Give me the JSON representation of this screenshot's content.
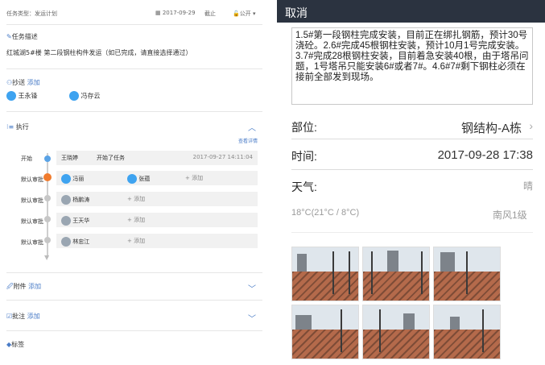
{
  "left": {
    "task_type": "任务类型：发运计划",
    "date": "2017-09-29",
    "due": "截止",
    "visibility": "公开",
    "desc_title": "任务描述",
    "desc_text": "红城湖5#楼 第二段钢柱构件发运（如已完成，请直接选择通过）",
    "cc_title": "抄送",
    "cc_add": "添加",
    "cc_people": [
      "王永锋",
      "冯存云"
    ],
    "exec_title": "执行",
    "view_details": "查看详情",
    "steps": [
      {
        "label": "开始",
        "name": "王晓婷",
        "action": "开始了任务",
        "time": "2017-09-27 14:11:04"
      },
      {
        "label": "默认审批",
        "name": "冯丽",
        "second": "张蕴",
        "add": "+ 添加"
      },
      {
        "label": "默认审批",
        "name": "杨鹏涛",
        "add": "+ 添加"
      },
      {
        "label": "默认审批",
        "name": "王天华",
        "add": "+ 添加"
      },
      {
        "label": "默认审批",
        "name": "林忠江",
        "add": "+ 添加"
      }
    ],
    "attach_title": "附件",
    "attach_add": "添加",
    "note_title": "批注",
    "note_add": "添加",
    "tag_title": "标签"
  },
  "right": {
    "header": "取消",
    "note": "1.5#第一段钢柱完成安装，目前正在绑扎钢筋，预计30号浇砼。2.6#完成45根钢柱安装，预计10月1号完成安装。3.7#完成28根钢柱安装，目前着急安装40根，由于塔吊问题，1号塔吊只能安装6#或者7#。4.6#7#剩下钢柱必须在接前全部发到现场。",
    "part_label": "部位:",
    "part_value": "钢结构-A栋",
    "time_label": "时间:",
    "time_value": "2017-09-28 17:38",
    "weather_label": "天气:",
    "weather_value": "晴",
    "temp": "18°C(21°C / 8°C)",
    "wind": "南风1级"
  }
}
